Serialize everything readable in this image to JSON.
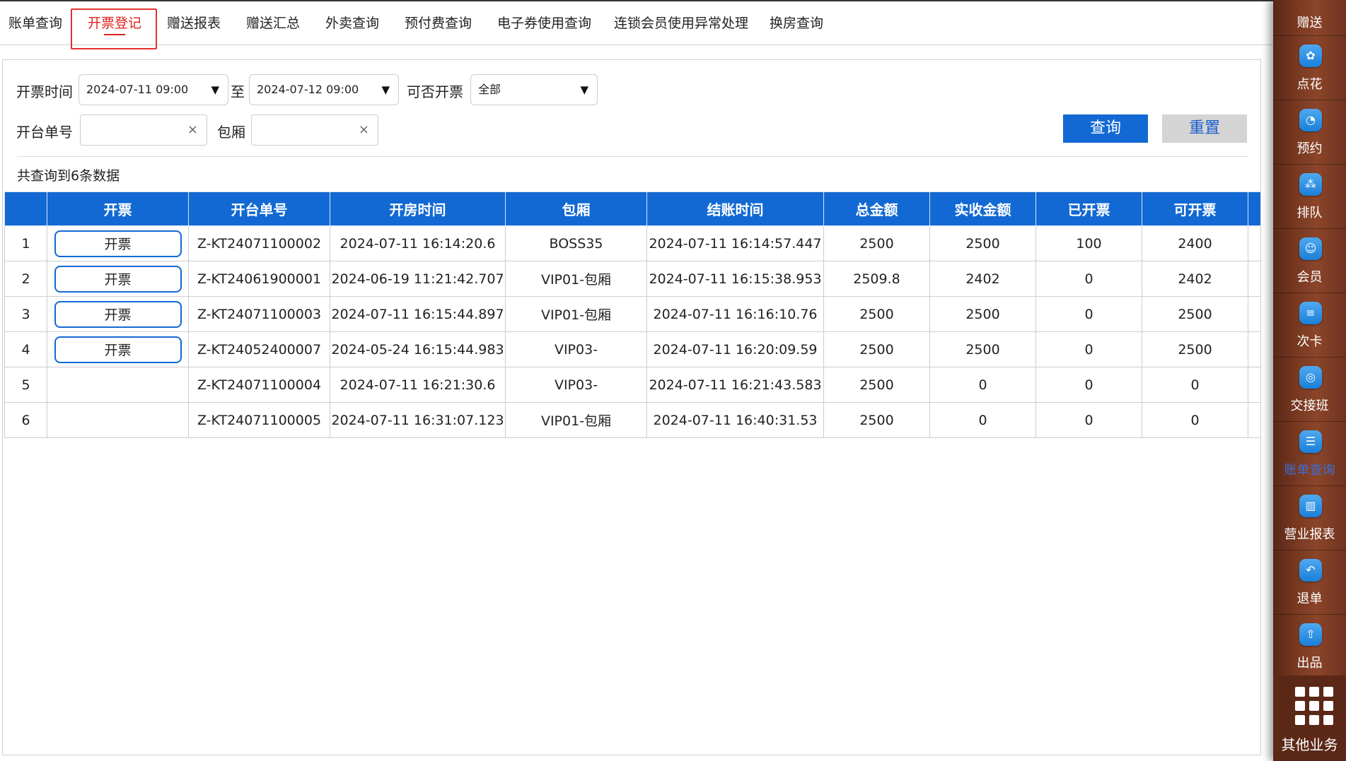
{
  "tabs": [
    {
      "label": "账单查询",
      "active": false
    },
    {
      "label": "开票登记",
      "active": true
    },
    {
      "label": "赠送报表",
      "active": false
    },
    {
      "label": "赠送汇总",
      "active": false
    },
    {
      "label": "外卖查询",
      "active": false
    },
    {
      "label": "预付费查询",
      "active": false
    },
    {
      "label": "电子券使用查询",
      "active": false
    },
    {
      "label": "连锁会员使用异常处理",
      "active": false
    },
    {
      "label": "换房查询",
      "active": false
    }
  ],
  "filters": {
    "invoice_time_label": "开票时间",
    "start_time": "2024-07-11 09:00",
    "to_label": "至",
    "end_time": "2024-07-12 09:00",
    "can_invoice_label": "可否开票",
    "can_invoice_value": "全部",
    "order_no_label": "开台单号",
    "order_no_value": "",
    "room_label": "包厢",
    "room_value": "",
    "clear_symbol": "×",
    "arrow_symbol": "▼"
  },
  "buttons": {
    "query": "查询",
    "reset": "重置"
  },
  "result_count": "共查询到6条数据",
  "table": {
    "headers": [
      "",
      "开票",
      "开台单号",
      "开房时间",
      "包厢",
      "结账时间",
      "总金额",
      "实收金额",
      "已开票",
      "可开票",
      ""
    ],
    "invoice_button_label": "开票",
    "rows": [
      {
        "index": "1",
        "has_button": true,
        "order_no": "Z-KT24071100002",
        "open_time": "2024-07-11 16:14:20.6",
        "room": "BOSS35",
        "checkout_time": "2024-07-11 16:14:57.447",
        "total": "2500",
        "received": "2500",
        "invoiced": "100",
        "invoiceable": "2400"
      },
      {
        "index": "2",
        "has_button": true,
        "order_no": "Z-KT24061900001",
        "open_time": "2024-06-19 11:21:42.707",
        "room": "VIP01-包厢",
        "checkout_time": "2024-07-11 16:15:38.953",
        "total": "2509.8",
        "received": "2402",
        "invoiced": "0",
        "invoiceable": "2402"
      },
      {
        "index": "3",
        "has_button": true,
        "order_no": "Z-KT24071100003",
        "open_time": "2024-07-11 16:15:44.897",
        "room": "VIP01-包厢",
        "checkout_time": "2024-07-11 16:16:10.76",
        "total": "2500",
        "received": "2500",
        "invoiced": "0",
        "invoiceable": "2500"
      },
      {
        "index": "4",
        "has_button": true,
        "order_no": "Z-KT24052400007",
        "open_time": "2024-05-24 16:15:44.983",
        "room": "VIP03-",
        "checkout_time": "2024-07-11 16:20:09.59",
        "total": "2500",
        "received": "2500",
        "invoiced": "0",
        "invoiceable": "2500"
      },
      {
        "index": "5",
        "has_button": false,
        "order_no": "Z-KT24071100004",
        "open_time": "2024-07-11 16:21:30.6",
        "room": "VIP03-",
        "checkout_time": "2024-07-11 16:21:43.583",
        "total": "2500",
        "received": "0",
        "invoiced": "0",
        "invoiceable": "0"
      },
      {
        "index": "6",
        "has_button": false,
        "order_no": "Z-KT24071100005",
        "open_time": "2024-07-11 16:31:07.123",
        "room": "VIP01-包厢",
        "checkout_time": "2024-07-11 16:40:31.53",
        "total": "2500",
        "received": "0",
        "invoiced": "0",
        "invoiceable": "0"
      }
    ]
  },
  "sidebar": {
    "items": [
      {
        "label": "赠送",
        "icon": "gift-icon",
        "active": false
      },
      {
        "label": "点花",
        "icon": "flower-icon",
        "active": false
      },
      {
        "label": "预约",
        "icon": "reservation-icon",
        "active": false
      },
      {
        "label": "排队",
        "icon": "queue-icon",
        "active": false
      },
      {
        "label": "会员",
        "icon": "member-icon",
        "active": false
      },
      {
        "label": "次卡",
        "icon": "card-icon",
        "active": false
      },
      {
        "label": "交接班",
        "icon": "shift-icon",
        "active": false
      },
      {
        "label": "账单查询",
        "icon": "bill-query-icon",
        "active": true
      },
      {
        "label": "营业报表",
        "icon": "report-icon",
        "active": false
      },
      {
        "label": "退单",
        "icon": "refund-icon",
        "active": false
      },
      {
        "label": "出品",
        "icon": "dispatch-icon",
        "active": false
      }
    ],
    "more_label": "其他业务",
    "more_icon": "grid-icon"
  },
  "colors": {
    "accent": "#1269d3",
    "active_tab": "#e02020",
    "sidebar_bg": "#7a3a22"
  }
}
